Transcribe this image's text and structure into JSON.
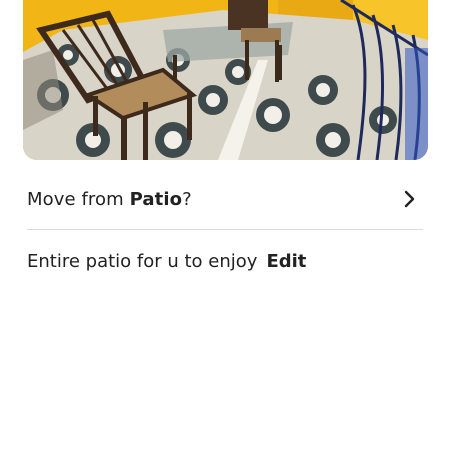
{
  "photo": {
    "subject": "patio with wooden chairs, glass table, and patterned tile floor"
  },
  "move_row": {
    "prefix": "Move from ",
    "room": "Patio",
    "suffix": "?",
    "icon": "chevron-right-icon"
  },
  "caption": {
    "text": "Entire patio for u to enjoy",
    "edit_label": "Edit"
  },
  "colors": {
    "text": "#222222",
    "divider": "#dddddd",
    "wall_yellow": "#f2b516",
    "railing_blue": "#2f56c4"
  }
}
